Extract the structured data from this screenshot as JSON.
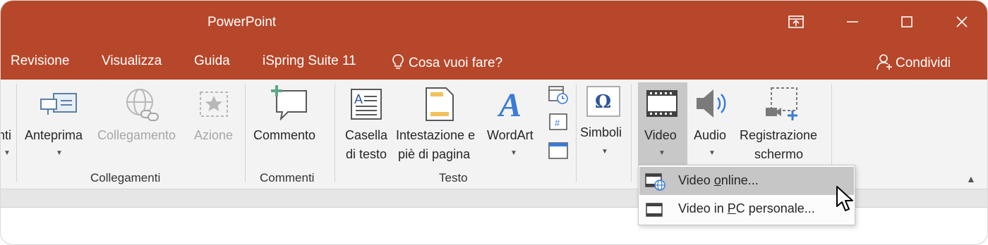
{
  "window": {
    "title": "PowerPoint",
    "controls": [
      "restore-ribbon",
      "minimize",
      "maximize",
      "close"
    ]
  },
  "tabs": {
    "items": [
      "Revisione",
      "Visualizza",
      "Guida",
      "iSpring Suite 11"
    ],
    "tell_me": "Cosa vuoi fare?",
    "share": "Condividi"
  },
  "ribbon": {
    "partial_label": "nti",
    "links": {
      "preview": "Anteprima",
      "link": "Collegamento",
      "action": "Azione",
      "group": "Collegamenti"
    },
    "comments": {
      "comment": "Commento",
      "group": "Commenti"
    },
    "text": {
      "textbox_l1": "Casella",
      "textbox_l2": "di testo",
      "header_l1": "Intestazione e",
      "header_l2": "piè di pagina",
      "wordart": "WordArt",
      "group": "Testo"
    },
    "symbols": {
      "label": "Simboli"
    },
    "media": {
      "video": "Video",
      "audio": "Audio",
      "rec_l1": "Registrazione",
      "rec_l2": "schermo"
    }
  },
  "video_menu": {
    "online_pre": "Video ",
    "online_u": "o",
    "online_post": "nline...",
    "pc_pre": "Video in ",
    "pc_u": "P",
    "pc_post": "C personale..."
  },
  "colors": {
    "accent": "#b7472a",
    "ribbon_bg": "#f3f3f3",
    "highlight": "#c6c6c6"
  }
}
